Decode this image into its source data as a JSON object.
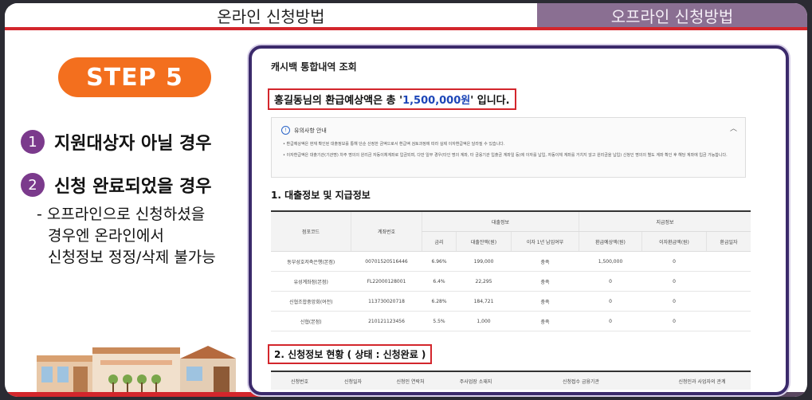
{
  "tabs": {
    "online": "온라인 신청방법",
    "offline": "오프라인 신청방법"
  },
  "step": {
    "label": "STEP 5"
  },
  "items": [
    {
      "num": "1",
      "text": "지원대상자 아닐 경우"
    },
    {
      "num": "2",
      "text": "신청 완료되었을 경우"
    }
  ],
  "subtext": [
    "- 오프라인으로 신청하셨을",
    "경우엔 온라인에서",
    "신청정보 정정/삭제 불가능"
  ],
  "panel": {
    "title": "캐시백 통합내역 조회",
    "refund_prefix": "홍길동님의 환급예상액은 총 '",
    "refund_amount": "1,500,000원",
    "refund_suffix": "' 입니다.",
    "notice_title": "유의사항 안내",
    "notice_lines": [
      "• 환급예상액은 현재 확인된 대출정보를 통해 단순 산정한 금액으로서 환급액 검토과정에 따라 실제 이자환급액은 달라질 수 있습니다.",
      "• 이자환급액은 대출기관(기관명) 차주 명의의 원리금 자동이체계좌로 입금되며, 다만 일부 경우(타인 명의 계좌, 타 금융기관 입출금 계좌일 등)에 이자를 납입, 자동이체 계좌를 거치지 않고 원리금을 납입) 신청인 명의의 별도 계좌 확인 후 해당 계좌에 입금 가능합니다."
    ],
    "section1": "1. 대출정보 및 지급정보",
    "section2": "2. 신청정보 현황 ( 상태 : 신청완료 )"
  },
  "table1": {
    "group_loan": "대출정보",
    "group_pay": "지급정보",
    "headers": [
      "점포코드",
      "계좌번호",
      "금리",
      "대출잔액(원)",
      "이자 1년 납입여부",
      "환급예상액(원)",
      "이자환급액(원)",
      "환급일자"
    ],
    "rows": [
      [
        "동부성호저축은행(본점)",
        "00701520516446",
        "6.96%",
        "199,000",
        "충족",
        "1,500,000",
        "0",
        ""
      ],
      [
        "유성계좌점(본점)",
        "FL22000128001",
        "6.4%",
        "22,295",
        "충족",
        "0",
        "0",
        ""
      ],
      [
        "신협조합중앙회(여전)",
        "113730020718",
        "6.28%",
        "184,721",
        "충족",
        "0",
        "0",
        ""
      ],
      [
        "신협(본점)",
        "210121123456",
        "5.5%",
        "1,000",
        "충족",
        "0",
        "0",
        ""
      ]
    ]
  },
  "table2": {
    "headers": [
      "신청번호",
      "신청일자",
      "신청인 연락처",
      "주사업장 소재지",
      "신청접수 금융기관",
      "신청인과 사업자의 관계"
    ]
  }
}
